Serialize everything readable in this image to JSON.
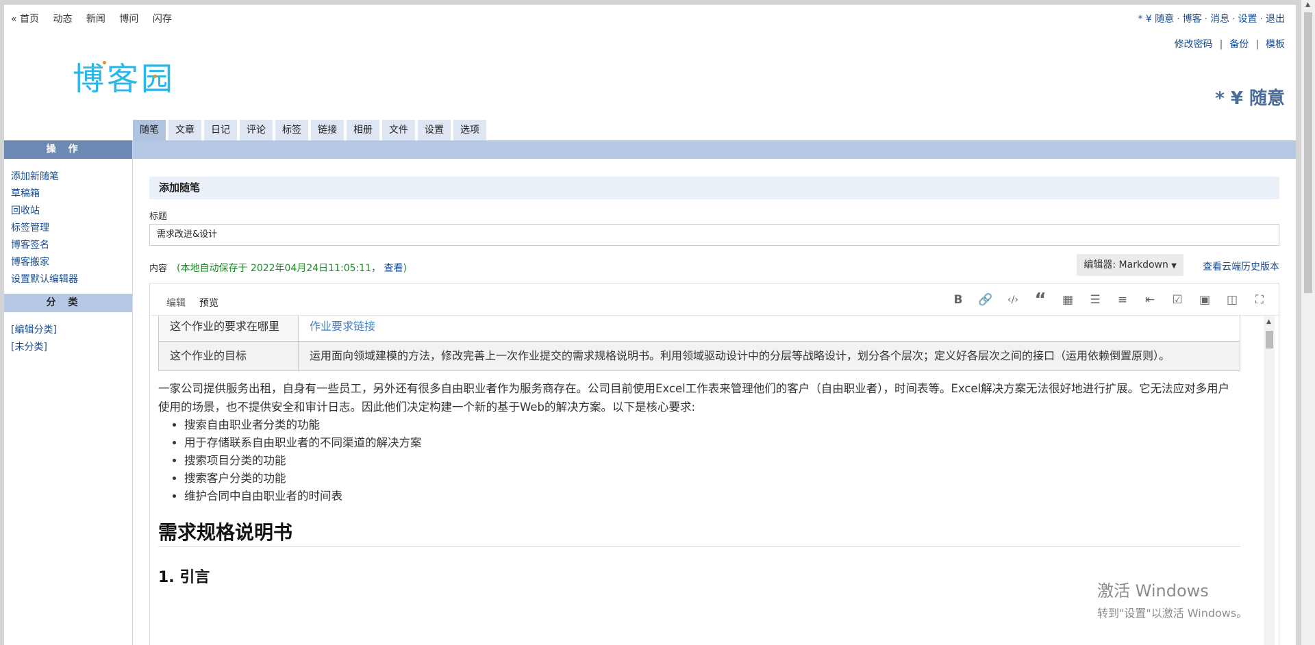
{
  "topnav": {
    "items": [
      "« 首页",
      "动态",
      "新闻",
      "博问",
      "闪存"
    ],
    "right_user": "* ¥ 随意",
    "right_items": [
      "博客",
      "消息",
      "设置",
      "退出"
    ]
  },
  "subnav": {
    "items": [
      "修改密码",
      "备份",
      "模板"
    ]
  },
  "logo": {
    "text": "博客园"
  },
  "blog_name": "* ¥ 随意",
  "tabs": [
    "随笔",
    "文章",
    "日记",
    "评论",
    "标签",
    "链接",
    "相册",
    "文件",
    "设置",
    "选项"
  ],
  "sidebar": {
    "ops_title": "操作",
    "ops_items": [
      "添加新随笔",
      "草稿箱",
      "回收站",
      "标签管理",
      "博客签名",
      "博客搬家",
      "设置默认编辑器"
    ],
    "cat_title": "分类",
    "cat_items": [
      "[编辑分类]",
      "[未分类]"
    ]
  },
  "main": {
    "box_title": "添加随笔",
    "title_label": "标题",
    "title_value": "需求改进&设计",
    "content_label": "内容",
    "autosave_text": "(本地自动保存于 2022年04月24日11:05:11，",
    "autosave_link": "查看",
    "autosave_end": ")",
    "editor_select": "编辑器: Markdown",
    "history_link": "查看云端历史版本"
  },
  "editor": {
    "tabs": [
      "编辑",
      "预览"
    ],
    "toolbar_icons": [
      "bold-icon",
      "link-icon",
      "code-icon",
      "quote-icon",
      "table-icon",
      "unordered-list-icon",
      "ordered-list-icon",
      "outdent-icon",
      "checkbox-icon",
      "image-icon",
      "split-view-icon",
      "fullscreen-icon"
    ],
    "table": [
      {
        "key": "这个作业的要求在哪里",
        "value": "作业要求链接"
      },
      {
        "key": "这个作业的目标",
        "value": "运用面向领域建模的方法，修改完善上一次作业提交的需求规格说明书。利用领域驱动设计中的分层等战略设计，划分各个层次；定义好各层次之间的接口（运用依赖倒置原则）。"
      }
    ],
    "paragraph": "一家公司提供服务出租，自身有一些员工，另外还有很多自由职业者作为服务商存在。公司目前使用Excel工作表来管理他们的客户（自由职业者），时间表等。Excel解决方案无法很好地进行扩展。它无法应对多用户使用的场景，也不提供安全和审计日志。因此他们决定构建一个新的基于Web的解决方案。以下是核心要求:",
    "bullets": [
      "搜索自由职业者分类的功能",
      "用于存储联系自由职业者的不同渠道的解决方案",
      "搜索项目分类的功能",
      "搜索客户分类的功能",
      "维护合同中自由职业者的时间表"
    ],
    "h2": "需求规格说明书",
    "h3": "1. 引言"
  },
  "watermark": {
    "line1": "激活 Windows",
    "line2": "转到\"设置\"以激活 Windows。"
  }
}
